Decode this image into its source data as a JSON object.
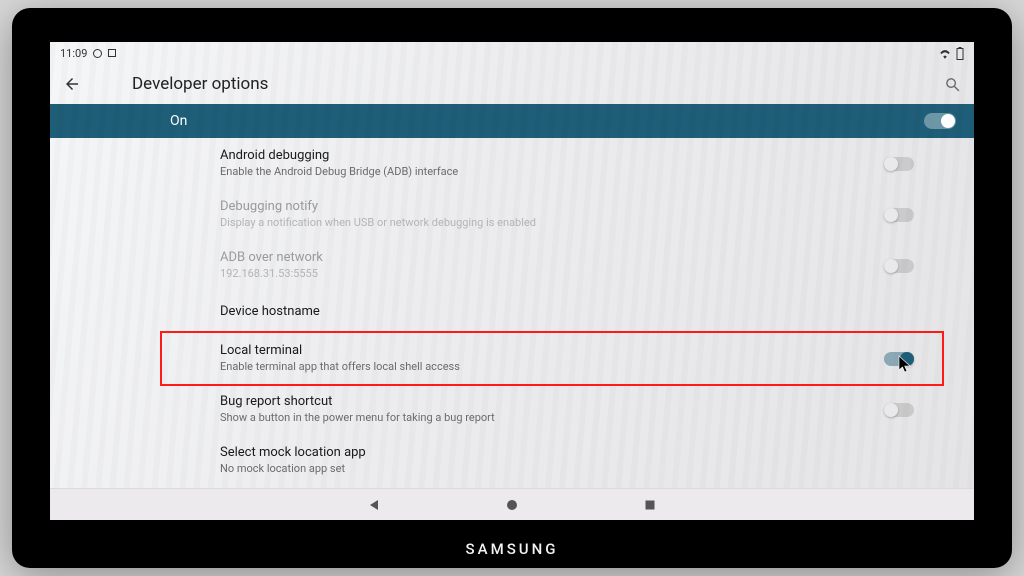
{
  "monitor_brand": "SAMSUNG",
  "statusbar": {
    "time": "11:09"
  },
  "appbar": {
    "title": "Developer options"
  },
  "master": {
    "label": "On",
    "on": true
  },
  "rows": {
    "android_debugging": {
      "title": "Android debugging",
      "subtitle": "Enable the Android Debug Bridge (ADB) interface"
    },
    "debugging_notify": {
      "title": "Debugging notify",
      "subtitle": "Display a notification when USB or network debugging is enabled"
    },
    "adb_over_network": {
      "title": "ADB over network",
      "subtitle": "192.168.31.53:5555"
    },
    "device_hostname": {
      "title": "Device hostname"
    },
    "local_terminal": {
      "title": "Local terminal",
      "subtitle": "Enable terminal app that offers local shell access"
    },
    "bug_report_shortcut": {
      "title": "Bug report shortcut",
      "subtitle": "Show a button in the power menu for taking a bug report"
    },
    "select_mock": {
      "title": "Select mock location app",
      "subtitle": "No mock location app set"
    }
  }
}
